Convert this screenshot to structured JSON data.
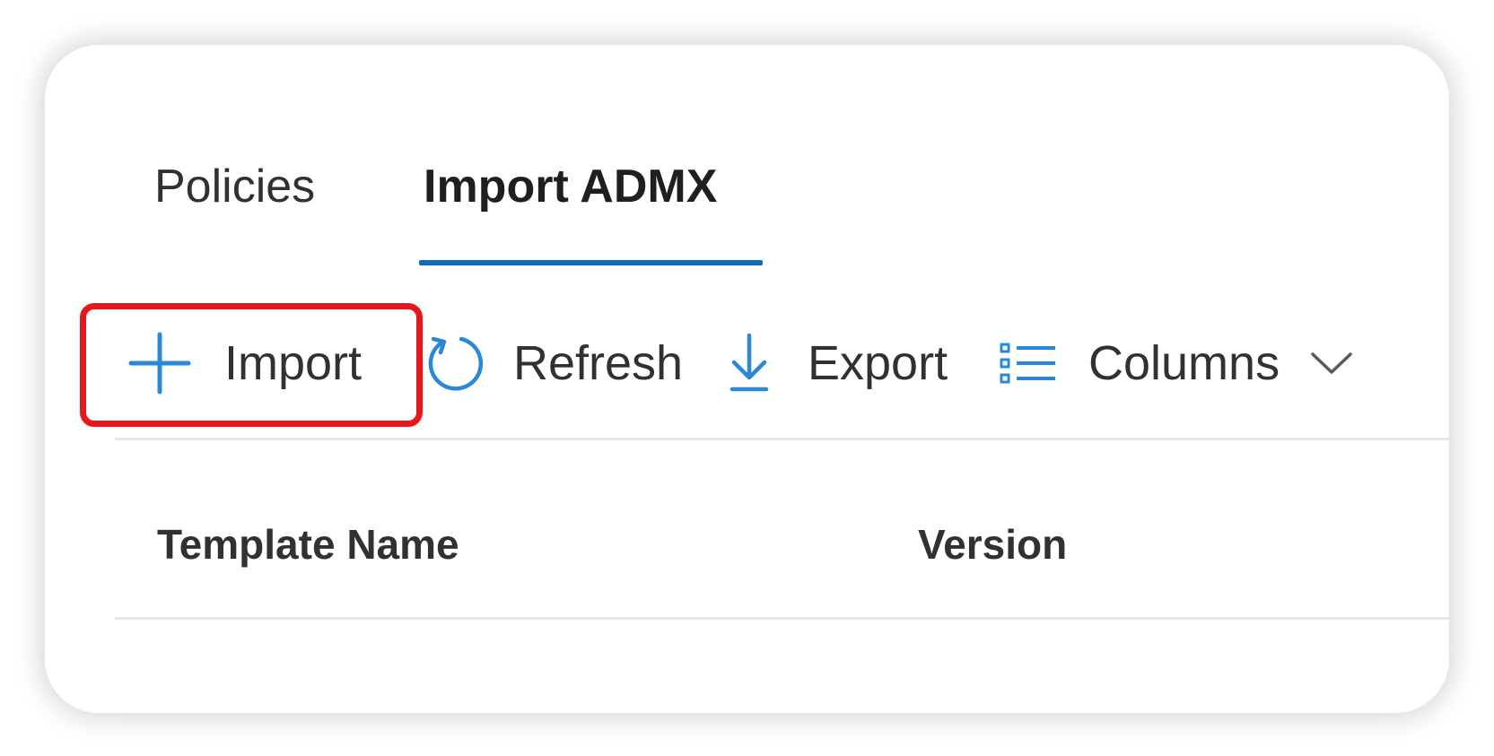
{
  "tabs": [
    {
      "label": "Policies",
      "selected": false
    },
    {
      "label": "Import ADMX",
      "selected": true
    }
  ],
  "toolbar": {
    "import": {
      "label": "Import",
      "icon": "plus-icon"
    },
    "refresh": {
      "label": "Refresh",
      "icon": "refresh-icon"
    },
    "export": {
      "label": "Export",
      "icon": "download-icon"
    },
    "columns": {
      "label": "Columns",
      "icon": "columns-list-icon",
      "dropdown_icon": "chevron-down-icon"
    }
  },
  "table": {
    "columns": [
      "Template Name",
      "Version"
    ]
  },
  "colors": {
    "accent": "#0f6cbd",
    "icon_blue": "#2b88d8",
    "highlight": "#e8151a",
    "text": "#323130"
  }
}
